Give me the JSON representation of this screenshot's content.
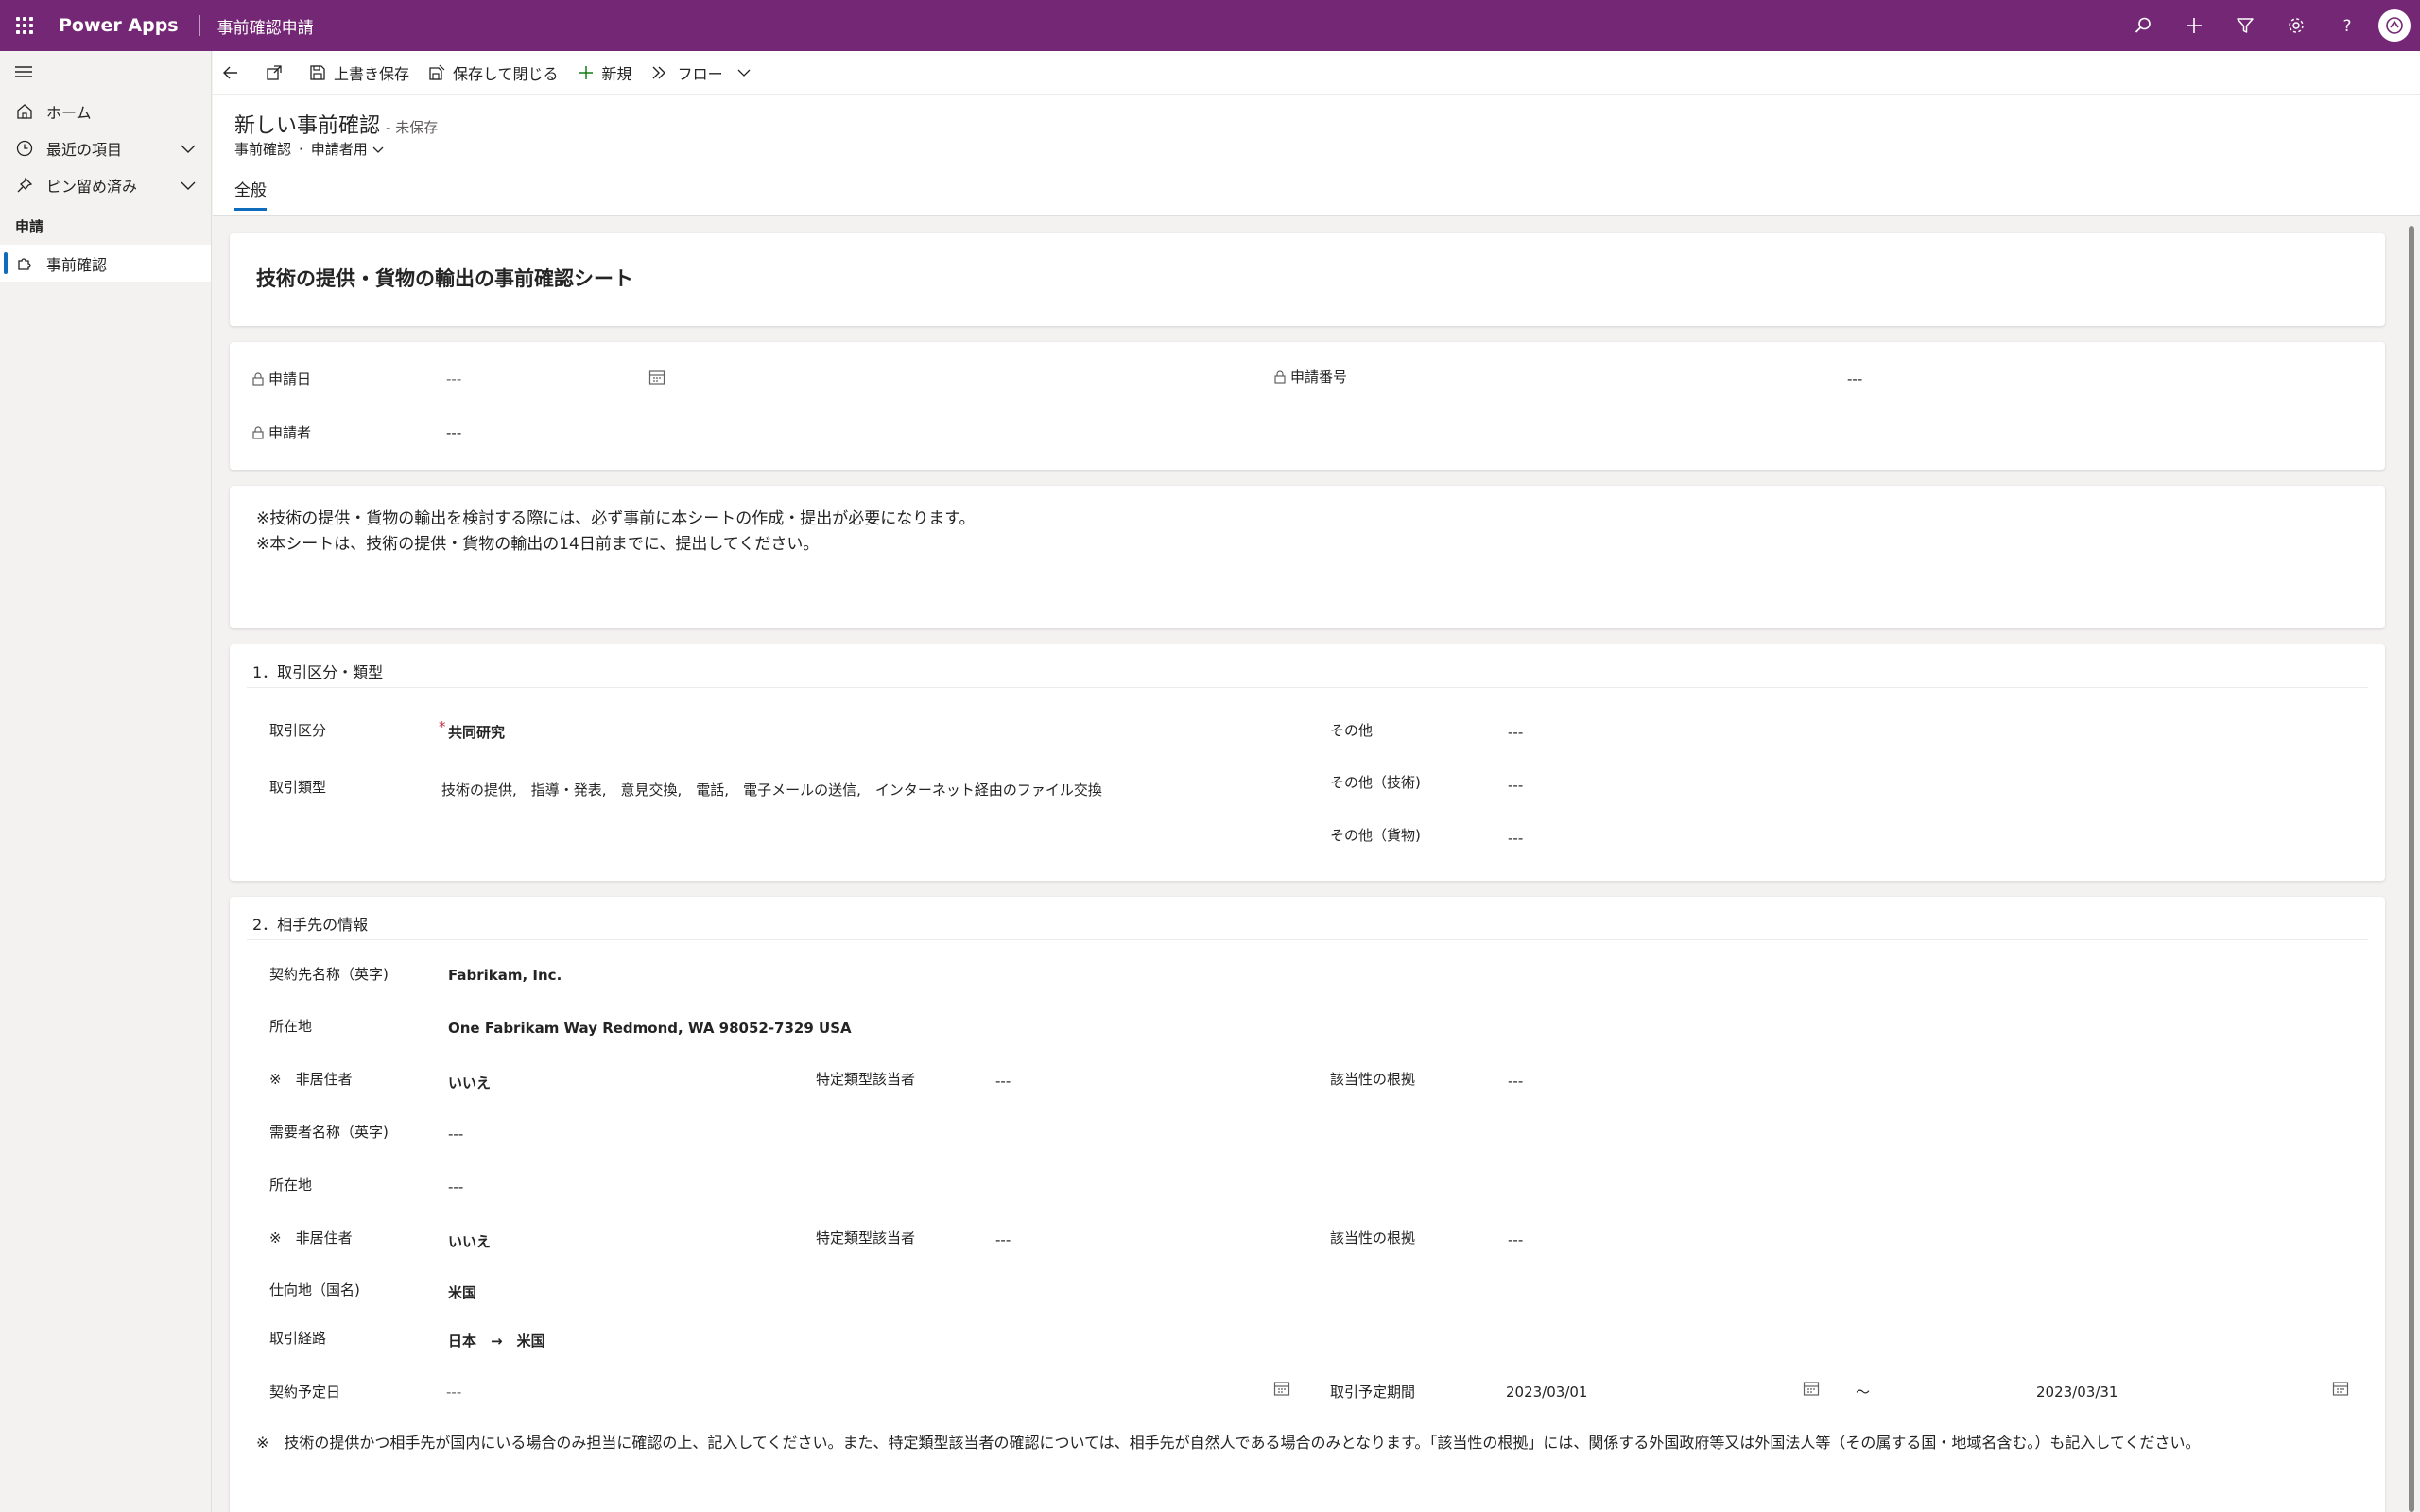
{
  "topbar": {
    "app_name": "Power Apps",
    "app_title": "事前確認申請",
    "icons": [
      "search-icon",
      "plus-icon",
      "filter-icon",
      "gear-icon",
      "help-icon",
      "avatar"
    ]
  },
  "nav": {
    "home": "ホーム",
    "recent": "最近の項目",
    "pinned": "ピン留め済み",
    "group": "申請",
    "active_item": "事前確認"
  },
  "cmdbar": {
    "save": "上書き保存",
    "save_close": "保存して閉じる",
    "new": "新規",
    "flow": "フロー"
  },
  "header": {
    "title": "新しい事前確認",
    "unsaved": "- 未保存",
    "entity": "事前確認",
    "form": "申請者用",
    "tab": "全般"
  },
  "sheet": {
    "title": "技術の提供・貨物の輸出の事前確認シート"
  },
  "meta": {
    "date_label": "申請日",
    "date_value": "---",
    "applicant_label": "申請者",
    "applicant_value": "---",
    "number_label": "申請番号",
    "number_value": "---"
  },
  "notice": {
    "line1": "※技術の提供・貨物の輸出を検討する際には、必ず事前に本シートの作成・提出が必要になります。",
    "line2": "※本シートは、技術の提供・貨物の輸出の14日前までに、提出してください。"
  },
  "section1": {
    "title": "1．取引区分・類型",
    "kubun_label": "取引区分",
    "kubun_value": "共同研究",
    "ruikei_label": "取引類型",
    "ruikei_value": "技術の提供,　指導・発表,　意見交換,　電話,　電子メールの送信,　インターネット経由のファイル交換",
    "other_label": "その他",
    "other_value": "---",
    "other_tech_label": "その他（技術)",
    "other_tech_value": "---",
    "other_goods_label": "その他（貨物)",
    "other_goods_value": "---"
  },
  "section2": {
    "title": "2．相手先の情報",
    "contract_name_label": "契約先名称（英字)",
    "contract_name_value": "Fabrikam, Inc.",
    "address1_label": "所在地",
    "address1_value": "One Fabrikam Way Redmond, WA 98052-7329 USA",
    "nonres1_label": "※　非居住者",
    "nonres1_value": "いいえ",
    "specific1_label": "特定類型該当者",
    "specific1_value": "---",
    "basis1_label": "該当性の根拠",
    "basis1_value": "---",
    "demander_label": "需要者名称（英字)",
    "demander_value": "---",
    "address2_label": "所在地",
    "address2_value": "---",
    "nonres2_label": "※　非居住者",
    "nonres2_value": "いいえ",
    "specific2_label": "特定類型該当者",
    "specific2_value": "---",
    "basis2_label": "該当性の根拠",
    "basis2_value": "---",
    "dest_label": "仕向地（国名)",
    "dest_value": "米国",
    "route_label": "取引経路",
    "route_value": "日本　→　米国",
    "contract_date_label": "契約予定日",
    "contract_date_value": "---",
    "period_label": "取引予定期間",
    "period_start": "2023/03/01",
    "period_sep": "〜",
    "period_end": "2023/03/31",
    "footnote": "※　技術の提供かつ相手先が国内にいる場合のみ担当に確認の上、記入してください。また、特定類型該当者の確認については、相手先が自然人である場合のみとなります。「該当性の根拠」には、関係する外国政府等又は外国法人等（その属する国・地域名含む。）も記入してください。"
  },
  "colors": {
    "topbar": "#742774",
    "accent": "#0f6cbd",
    "required": "#c4314b"
  }
}
